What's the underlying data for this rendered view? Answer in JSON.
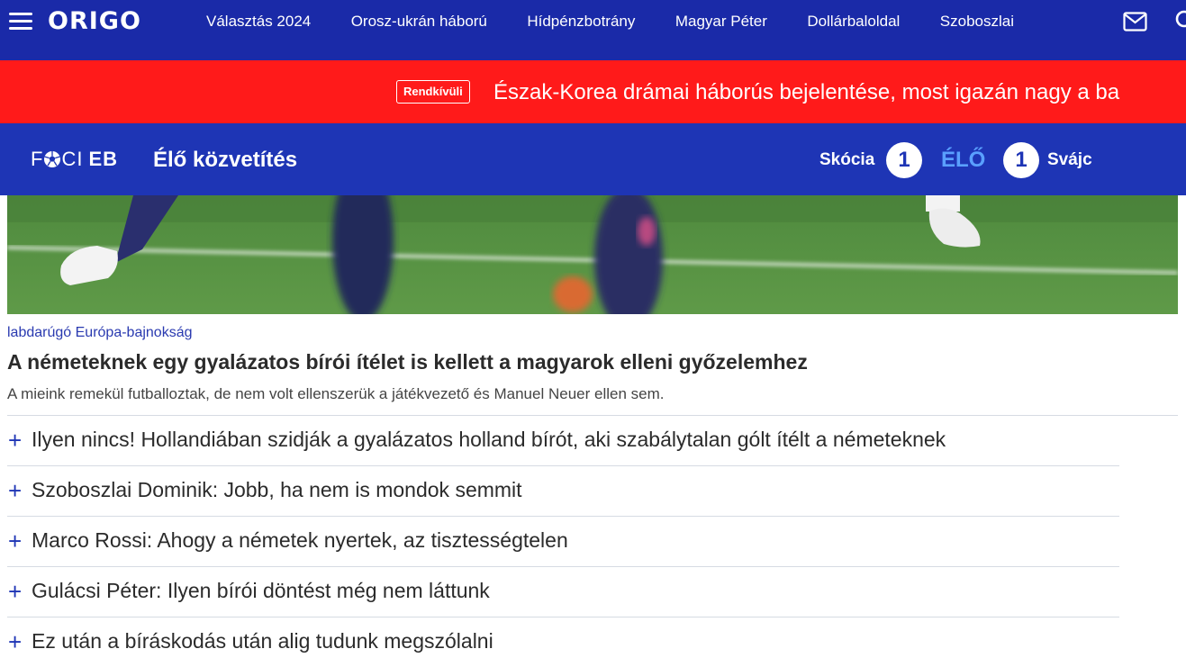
{
  "site": {
    "logo": "ORIGO"
  },
  "nav": {
    "links": [
      "Választás 2024",
      "Orosz-ukrán háború",
      "Hídpénzbotrány",
      "Magyar Péter",
      "Dollárbaloldal",
      "Szoboszlai"
    ]
  },
  "breaking": {
    "badge": "Rendkívüli",
    "text": "Észak-Korea drámai háborús bejelentése, most igazán nagy a ba"
  },
  "live": {
    "brand_left": "F CI",
    "brand_right": "EB",
    "title": "Élő közvetítés",
    "home_team": "Skócia",
    "home_score": "1",
    "status": "ÉLŐ",
    "away_score": "1",
    "away_team": "Svájc"
  },
  "article": {
    "category": "labdarúgó Európa-bajnokság",
    "headline": "A németeknek egy gyalázatos bírói ítélet is kellett a magyarok elleni győzelemhez",
    "lead": "A mieink remekül futballoztak, de nem volt ellenszerük a játékvezető és Manuel Neuer ellen sem."
  },
  "related": [
    "Ilyen nincs! Hollandiában szidják a gyalázatos holland bírót, aki szabálytalan gólt ítélt a németeknek",
    "Szoboszlai Dominik: Jobb, ha nem is mondok semmit",
    "Marco Rossi: Ahogy a németek nyertek, az tisztességtelen",
    "Gulácsi Péter: Ilyen bírói döntést még nem láttunk",
    "Ez után a bíráskodás után alig tudunk megszólalni"
  ],
  "icons": {
    "menu": "hamburger-menu-icon",
    "mail": "envelope-icon",
    "search": "search-icon",
    "ball": "football-icon",
    "plus": "plus-icon"
  },
  "colors": {
    "nav_bg": "#1a2aa8",
    "breaking_bg": "#ff1a1a",
    "live_bg": "#1e35b5",
    "live_label": "#5aa0ff",
    "link": "#2a3ab0",
    "text": "#2b2b2b"
  }
}
